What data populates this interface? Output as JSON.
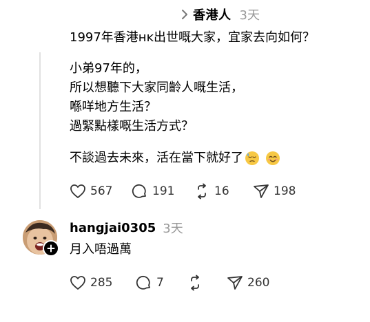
{
  "parent_post": {
    "author": "香港人",
    "time": "3天",
    "question": "1997年香港ʜᴋ出世嘅大家，宜家去向如何？"
  },
  "post": {
    "lines": [
      "小弟97年的，",
      "所以想聽下大家同齡人嘅生活，",
      "喺咩地方生活？",
      "過緊點樣嘅生活方式？"
    ],
    "extra_text": "不談過去未來，活在當下就好了",
    "emojis": [
      "downcast-sweat-face-emoji",
      "smiling-blush-face-emoji"
    ],
    "actions": {
      "likes": "567",
      "replies": "191",
      "reposts": "16",
      "shares": "198"
    }
  },
  "reply": {
    "username": "hangjai0305",
    "time": "3天",
    "text": "月入唔過萬",
    "actions": {
      "likes": "285",
      "replies": "7",
      "shares": "260"
    }
  },
  "colors": {
    "text": "#000000",
    "muted": "#999999",
    "icon": "#333333",
    "divider": "#e1e1e1"
  }
}
